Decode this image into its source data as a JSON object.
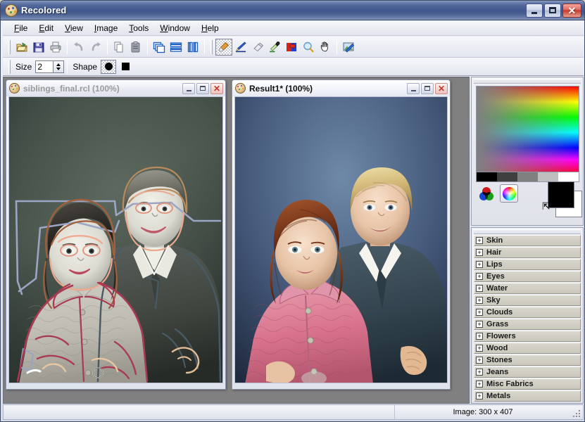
{
  "window": {
    "title": "Recolored",
    "icon": "palette-icon",
    "buttons": {
      "minimize": "_",
      "maximize": "□",
      "close": "✕"
    }
  },
  "menu": {
    "items": [
      {
        "label": "File",
        "accel": "F"
      },
      {
        "label": "Edit",
        "accel": "E"
      },
      {
        "label": "View",
        "accel": "V"
      },
      {
        "label": "Image",
        "accel": "I"
      },
      {
        "label": "Tools",
        "accel": "T"
      },
      {
        "label": "Window",
        "accel": "W"
      },
      {
        "label": "Help",
        "accel": "H"
      }
    ]
  },
  "toolbar": {
    "buttons": [
      {
        "name": "open-file-button",
        "tip": "Open"
      },
      {
        "name": "save-file-button",
        "tip": "Save"
      },
      {
        "name": "print-button",
        "tip": "Print"
      },
      {
        "name": "undo-button",
        "tip": "Undo"
      },
      {
        "name": "redo-button",
        "tip": "Redo"
      },
      {
        "name": "copy-button",
        "tip": "Copy"
      },
      {
        "name": "paste-button",
        "tip": "Paste"
      },
      {
        "name": "cascade-windows-button",
        "tip": "Cascade"
      },
      {
        "name": "tile-horizontal-button",
        "tip": "Tile Horizontally"
      },
      {
        "name": "tile-vertical-button",
        "tip": "Tile Vertically"
      },
      {
        "name": "brush-tool-button",
        "tip": "Brush",
        "selected": true
      },
      {
        "name": "line-tool-button",
        "tip": "Line"
      },
      {
        "name": "eraser-tool-button",
        "tip": "Eraser"
      },
      {
        "name": "color-picker-tool-button",
        "tip": "Pick Color"
      },
      {
        "name": "recolor-tool-button",
        "tip": "Recolor"
      },
      {
        "name": "zoom-tool-button",
        "tip": "Zoom"
      },
      {
        "name": "pan-tool-button",
        "tip": "Pan"
      },
      {
        "name": "image-properties-button",
        "tip": "Image"
      }
    ]
  },
  "options_bar": {
    "size_label": "Size",
    "size_value": "2",
    "shape_label": "Shape",
    "shape_round": "round-brush-shape",
    "shape_square": "square-brush-shape",
    "shape_selected": "round"
  },
  "documents": [
    {
      "title": "siblings_final.rcl (100%)",
      "zoom": "100%",
      "active": false,
      "buttons": {
        "minimize": "_",
        "maximize": "□",
        "close": "✕"
      }
    },
    {
      "title": "Result1* (100%)",
      "zoom": "100%",
      "active": true,
      "buttons": {
        "minimize": "_",
        "maximize": "□",
        "close": "✕"
      }
    }
  ],
  "color_panel": {
    "gradient_name": "hue-saturation-gradient",
    "gray_ramp": [
      "#000000",
      "#3f3f3f",
      "#808080",
      "#bfbfbf",
      "#ffffff"
    ],
    "mode_buttons": [
      {
        "name": "rgb-venn-mode-button",
        "selected": false
      },
      {
        "name": "color-wheel-mode-button",
        "selected": true
      }
    ],
    "foreground_color": "#000000",
    "background_color": "#ffffff",
    "swap_colors_icon": "swap-colors-arrow-icon"
  },
  "categories": [
    {
      "label": "Skin",
      "expander": "+"
    },
    {
      "label": "Hair",
      "expander": "+"
    },
    {
      "label": "Lips",
      "expander": "+"
    },
    {
      "label": "Eyes",
      "expander": "+"
    },
    {
      "label": "Water",
      "expander": "+"
    },
    {
      "label": "Sky",
      "expander": "+"
    },
    {
      "label": "Clouds",
      "expander": "+"
    },
    {
      "label": "Grass",
      "expander": "+"
    },
    {
      "label": "Flowers",
      "expander": "+"
    },
    {
      "label": "Wood",
      "expander": "+"
    },
    {
      "label": "Stones",
      "expander": "+"
    },
    {
      "label": "Jeans",
      "expander": "+"
    },
    {
      "label": "Misc Fabrics",
      "expander": "+"
    },
    {
      "label": "Metals",
      "expander": "+"
    }
  ],
  "status_bar": {
    "left": "",
    "image_info": "Image: 300 x 407"
  }
}
